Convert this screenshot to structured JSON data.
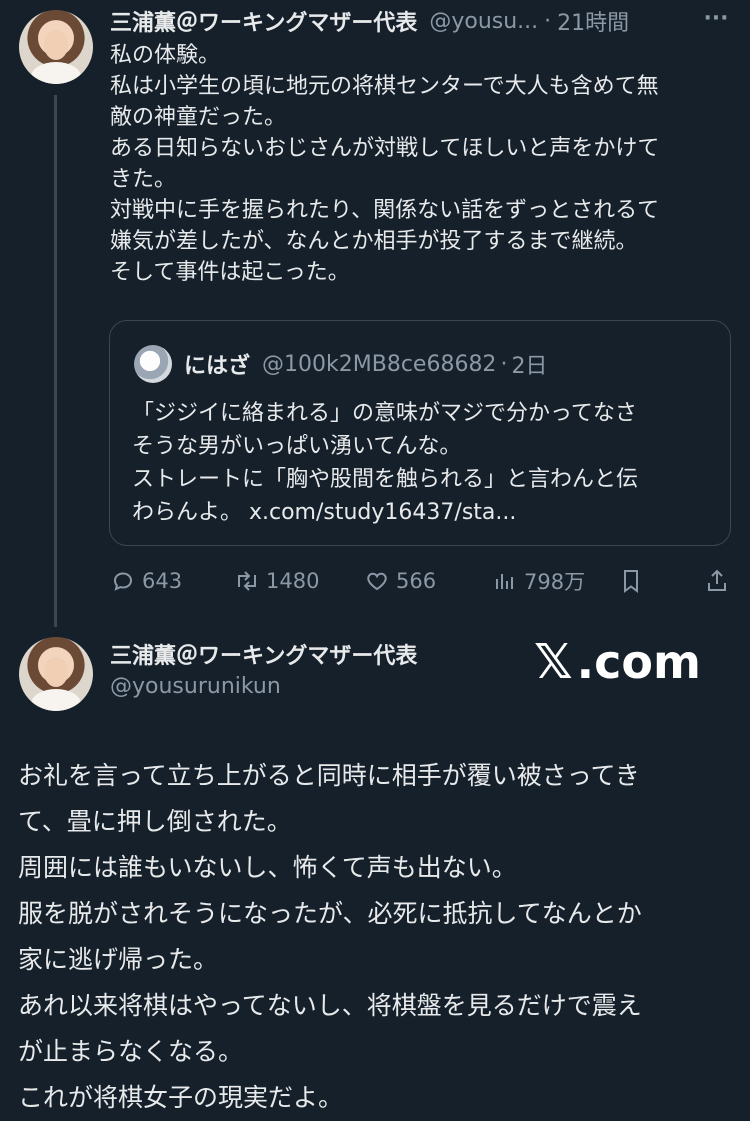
{
  "tweet": {
    "author_name": "三浦薫＠ワーキングマザー代表",
    "handle": "@yousu...",
    "separator": "·",
    "time": "21時間",
    "more": "···",
    "lines": [
      "私の体験。",
      "私は小学生の頃に地元の将棋センターで大人も含めて無",
      "敵の神童だった。",
      "ある日知らないおじさんが対戦してほしいと声をかけて",
      "きた。",
      "対戦中に手を握られたり、関係ない話をずっとされるて",
      "嫌気が差したが、なんとか相手が投了するまで継続。",
      "そして事件は起こった。"
    ],
    "quote": {
      "author_name": "にはざ",
      "handle": "@100k2MB8ce68682",
      "separator": "·",
      "time": "2日",
      "lines": [
        "「ジジイに絡まれる」の意味がマジで分かってなさ",
        "そうな男がいっぱい湧いてんな。",
        "ストレートに「胸や股間を触られる」と言わんと伝",
        "わらんよ。 x.com/study16437/sta..."
      ]
    },
    "actions": {
      "replies": "643",
      "retweets": "1480",
      "likes": "566",
      "views": "798万"
    }
  },
  "tweet2": {
    "author_name": "三浦薫＠ワーキングマザー代表",
    "handle": "@yousurunikun",
    "logo_mark": "𝕏",
    "logo_text": ".com",
    "lines": [
      "お礼を言って立ち上がると同時に相手が覆い被さってき",
      "て、畳に押し倒された。",
      "周囲には誰もいないし、怖くて声も出ない。",
      "服を脱がされそうになったが、必死に抵抗してなんとか",
      "家に逃げ帰った。",
      "あれ以来将棋はやってないし、将棋盤を見るだけで震え",
      "が止まらなくなる。",
      "これが将棋女子の現実だよ。"
    ]
  },
  "colors": {
    "background": "#15202b",
    "text": "#e7e9ea",
    "secondary": "#8b98a5",
    "border": "#3b4650"
  }
}
